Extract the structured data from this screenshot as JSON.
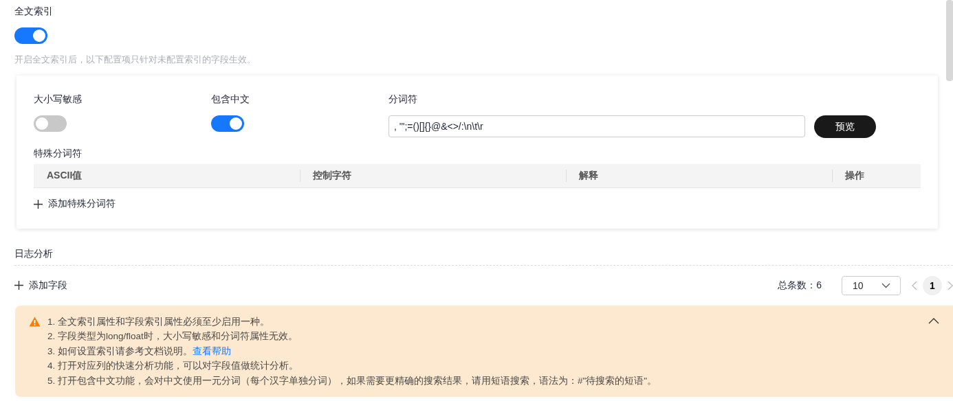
{
  "full_text_index": {
    "title": "全文索引",
    "enabled": true,
    "description": "开启全文索引后，以下配置项只针对未配置索引的字段生效。"
  },
  "settings": {
    "case_sensitive": {
      "label": "大小写敏感",
      "on": false
    },
    "include_chinese": {
      "label": "包含中文",
      "on": true
    },
    "delimiter": {
      "label": "分词符",
      "value": ", '\";=()[]{}@&<>/:\\n\\t\\r"
    },
    "preview_button": "预览"
  },
  "special_delimiters": {
    "title": "特殊分词符",
    "columns": [
      "ASCII值",
      "控制字符",
      "解释",
      "操作"
    ],
    "add_label": "添加特殊分词符"
  },
  "log_analysis": {
    "title": "日志分析",
    "add_field_label": "添加字段",
    "total": "总条数：6",
    "page_size": "10",
    "pages": [
      {
        "label": "1",
        "selected": true
      }
    ]
  },
  "notice": {
    "expanded": true,
    "items": [
      {
        "text": "1. 全文索引属性和字段索引属性必须至少启用一种。"
      },
      {
        "text": "2. 字段类型为long/float时，大小写敏感和分词符属性无效。"
      },
      {
        "text": "3. 如何设置索引请参考文档说明。",
        "link": "查看帮助"
      },
      {
        "text": "4. 打开对应列的快速分析功能，可以对字段值做统计分析。"
      },
      {
        "text": "5. 打开包含中文功能，会对中文使用一元分词（每个汉字单独分词），如果需要更精确的搜索结果，请用短语搜索，语法为：#\"待搜索的短语\"。"
      }
    ]
  }
}
